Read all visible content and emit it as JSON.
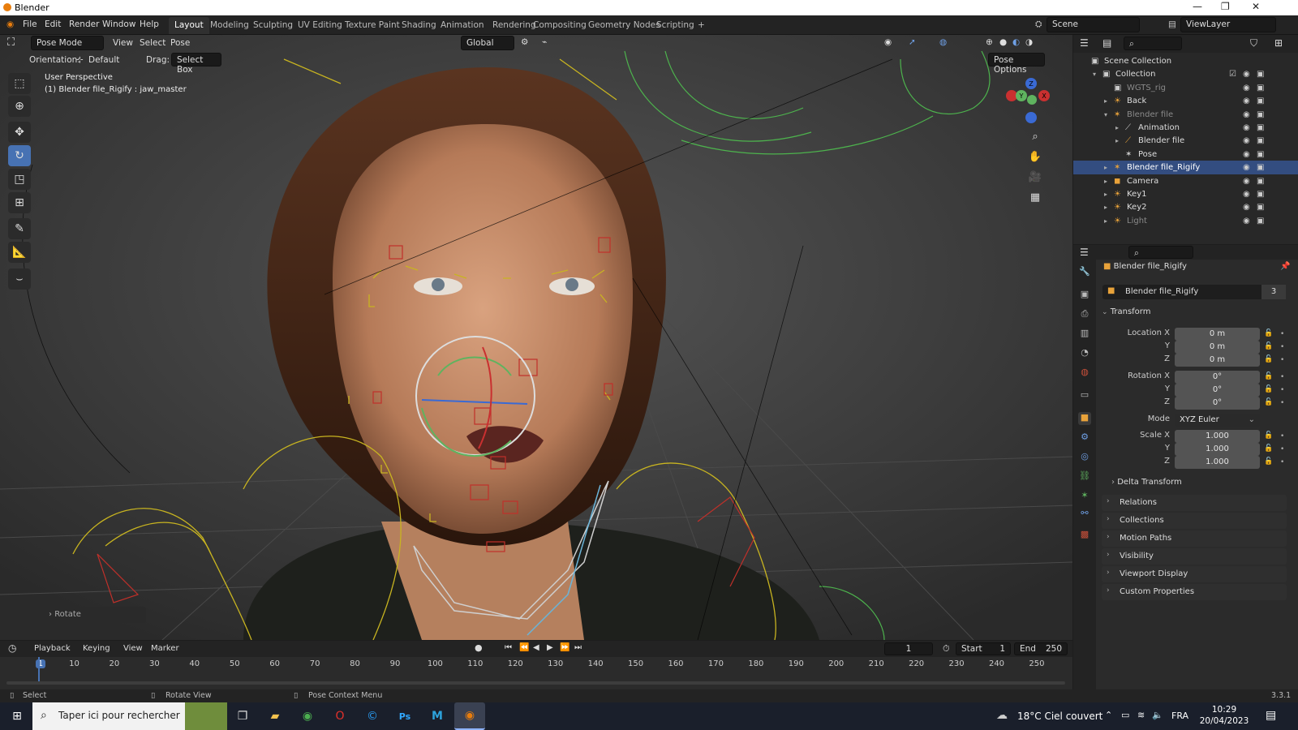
{
  "window": {
    "title": "Blender"
  },
  "menu": {
    "file": "File",
    "edit": "Edit",
    "render": "Render",
    "window": "Window",
    "help": "Help"
  },
  "workspaces": [
    "Layout",
    "Modeling",
    "Sculpting",
    "UV Editing",
    "Texture Paint",
    "Shading",
    "Animation",
    "Rendering",
    "Compositing",
    "Geometry Nodes",
    "Scripting",
    "+"
  ],
  "active_workspace": "Layout",
  "scene": {
    "label": "Scene",
    "viewlayer": "ViewLayer"
  },
  "viewport_header": {
    "mode": "Pose Mode",
    "view": "View",
    "select": "Select",
    "pose": "Pose",
    "transform_orientation": "Global",
    "orientation_label": "Orientation:",
    "orientation_value": "Default",
    "drag_label": "Drag:",
    "drag_value": "Select Box",
    "pose_options": "Pose Options"
  },
  "viewport": {
    "perspective": "User Perspective",
    "active_info": "(1) Blender file_Rigify : jaw_master",
    "last_op": "Rotate"
  },
  "gizmo": {
    "x": "X",
    "y": "Y",
    "z": "Z"
  },
  "tools": [
    "select-box-icon",
    "cursor-icon",
    "move-icon",
    "rotate-icon",
    "scale-icon",
    "transform-icon",
    "annotate-icon",
    "measure-icon",
    "relax-icon"
  ],
  "outliner": {
    "items": [
      {
        "label": "Scene Collection",
        "icon": "▣",
        "indent": 0,
        "tri": ""
      },
      {
        "label": "Collection",
        "icon": "▣",
        "indent": 1,
        "tri": "▾"
      },
      {
        "label": "WGTS_rig",
        "icon": "▣",
        "indent": 2,
        "tri": "",
        "dim": true
      },
      {
        "label": "Back",
        "icon": "☀",
        "indent": 2,
        "tri": "▸"
      },
      {
        "label": "Blender file",
        "icon": "✶",
        "indent": 2,
        "tri": "▾",
        "dim": true
      },
      {
        "label": "Animation",
        "icon": "⟋",
        "indent": 3,
        "tri": "▸"
      },
      {
        "label": "Blender file",
        "icon": "⟋",
        "indent": 3,
        "tri": "▸"
      },
      {
        "label": "Pose",
        "icon": "✶",
        "indent": 3,
        "tri": ""
      },
      {
        "label": "Blender file_Rigify",
        "icon": "✶",
        "indent": 2,
        "tri": "▸",
        "selected": true
      },
      {
        "label": "Camera",
        "icon": "◼",
        "indent": 2,
        "tri": "▸"
      },
      {
        "label": "Key1",
        "icon": "☀",
        "indent": 2,
        "tri": "▸"
      },
      {
        "label": "Key2",
        "icon": "☀",
        "indent": 2,
        "tri": "▸"
      },
      {
        "label": "Light",
        "icon": "☀",
        "indent": 2,
        "tri": "▸",
        "dim": true
      }
    ]
  },
  "properties": {
    "object_name": "Blender file_Rigify",
    "data_name": "Blender file_Rigify",
    "users": "3",
    "transform": "Transform",
    "location_x_label": "Location X",
    "location_x": "0 m",
    "location_y_label": "Y",
    "location_y": "0 m",
    "location_z_label": "Z",
    "location_z": "0 m",
    "rotation_x_label": "Rotation X",
    "rotation_x": "0°",
    "rotation_y_label": "Y",
    "rotation_y": "0°",
    "rotation_z_label": "Z",
    "rotation_z": "0°",
    "mode_label": "Mode",
    "mode": "XYZ Euler",
    "scale_x_label": "Scale X",
    "scale_x": "1.000",
    "scale_y_label": "Y",
    "scale_y": "1.000",
    "scale_z_label": "Z",
    "scale_z": "1.000",
    "delta_transform": "Delta Transform",
    "panels": [
      "Relations",
      "Collections",
      "Motion Paths",
      "Visibility",
      "Viewport Display",
      "Custom Properties"
    ]
  },
  "timeline": {
    "playback": "Playback",
    "keying": "Keying",
    "view": "View",
    "marker": "Marker",
    "current_frame": "1",
    "start_label": "Start",
    "start": "1",
    "end_label": "End",
    "end": "250",
    "ticks": [
      "1",
      "10",
      "20",
      "30",
      "40",
      "50",
      "60",
      "70",
      "80",
      "90",
      "100",
      "110",
      "120",
      "130",
      "140",
      "150",
      "160",
      "170",
      "180",
      "190",
      "200",
      "210",
      "220",
      "230",
      "240",
      "250"
    ]
  },
  "status": {
    "select": "Select",
    "rotate_view": "Rotate View",
    "context": "Pose Context Menu",
    "version": "3.3.1"
  },
  "taskbar": {
    "search_placeholder": "Taper ici pour rechercher",
    "weather": "18°C Ciel couvert",
    "lang": "FRA",
    "time": "10:29",
    "date": "20/04/2023"
  }
}
